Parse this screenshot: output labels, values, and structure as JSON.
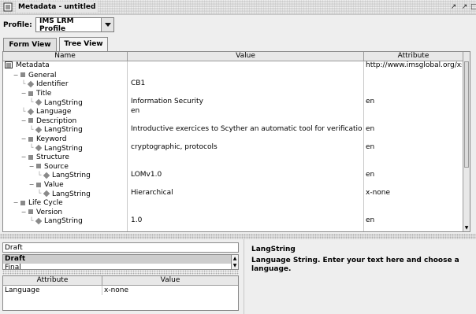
{
  "window": {
    "title": "Metadata - untitled"
  },
  "profile": {
    "label": "Profile:",
    "value": "IMS LRM Profile"
  },
  "tabs": [
    {
      "label": "Form View",
      "active": false
    },
    {
      "label": "Tree View",
      "active": true
    }
  ],
  "tree_table": {
    "columns": [
      "Name",
      "Value",
      "Attribute"
    ],
    "rows": [
      {
        "name": "Metadata",
        "value": "",
        "attribute": "http://www.imsglobal.org/xs..."
      },
      {
        "name": "General",
        "value": "",
        "attribute": ""
      },
      {
        "name": "Identifier",
        "value": "CB1",
        "attribute": ""
      },
      {
        "name": "Title",
        "value": "",
        "attribute": ""
      },
      {
        "name": "LangString",
        "value": "Information Security",
        "attribute": "en"
      },
      {
        "name": "Language",
        "value": "en",
        "attribute": ""
      },
      {
        "name": "Description",
        "value": "",
        "attribute": ""
      },
      {
        "name": "LangString",
        "value": "Introductive exercices to Scyther an automatic tool for verificationof...",
        "attribute": "en"
      },
      {
        "name": "Keyword",
        "value": "",
        "attribute": ""
      },
      {
        "name": "LangString",
        "value": "cryptographic, protocols",
        "attribute": "en"
      },
      {
        "name": "Structure",
        "value": "",
        "attribute": ""
      },
      {
        "name": "Source",
        "value": "",
        "attribute": ""
      },
      {
        "name": "LangString",
        "value": "LOMv1.0",
        "attribute": "en"
      },
      {
        "name": "Value",
        "value": "",
        "attribute": ""
      },
      {
        "name": "LangString",
        "value": "Hierarchical",
        "attribute": "x-none"
      },
      {
        "name": "Life Cycle",
        "value": "",
        "attribute": ""
      },
      {
        "name": "Version",
        "value": "",
        "attribute": ""
      },
      {
        "name": "LangString",
        "value": "1.0",
        "attribute": "en"
      }
    ]
  },
  "editor": {
    "input_value": "Draft",
    "list_items": [
      "Draft",
      "Final"
    ],
    "selected": "Draft",
    "attr_columns": [
      "Attribute",
      "Value"
    ],
    "attr_rows": [
      {
        "attribute": "Language",
        "value": "x-none"
      }
    ]
  },
  "description": {
    "title": "LangString",
    "text": "Language String. Enter your text here and choose a language."
  }
}
